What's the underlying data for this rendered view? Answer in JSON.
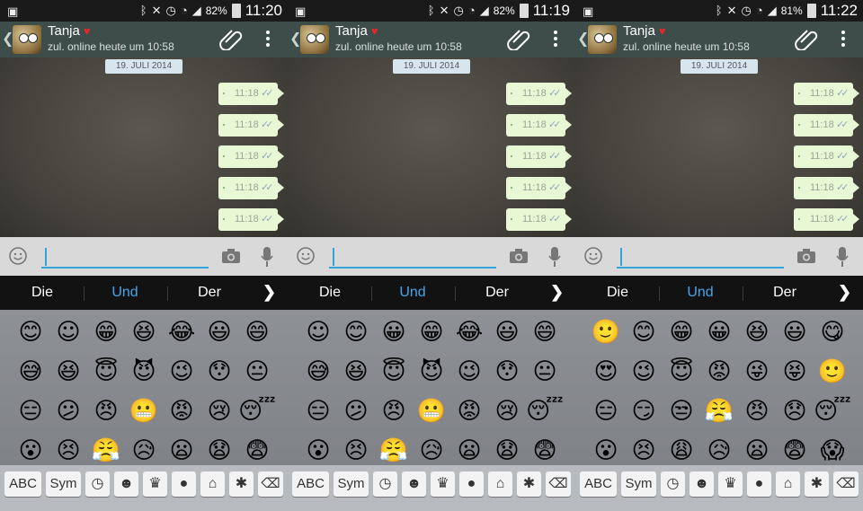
{
  "panels": [
    {
      "status": {
        "battery": "82%",
        "time": "11:20"
      },
      "chat": {
        "contact_name": "Tanja",
        "heart": "♥",
        "contact_status": "zul. online heute um 10:58",
        "date_pill": "19. JULI 2014",
        "messages": [
          {
            "time": "11:18",
            "ticks": "✓✓"
          },
          {
            "time": "11:18",
            "ticks": "✓✓"
          },
          {
            "time": "11:18",
            "ticks": "✓✓"
          },
          {
            "time": "11:18",
            "ticks": "✓✓"
          },
          {
            "time": "11:18",
            "ticks": "✓✓"
          }
        ]
      },
      "suggestions": [
        "Die",
        "Und",
        "Der"
      ],
      "emoji": [
        "😊",
        "☺",
        "😁",
        "😆",
        "😂",
        "😃",
        "😄",
        "😅",
        "😆",
        "😇",
        "😈",
        "😉",
        "😯",
        "😐",
        "😑",
        "😕",
        "😠",
        "😬",
        "😡",
        "😢",
        "😴",
        "😮",
        "😣",
        "😤",
        "😥",
        "😦",
        "😧",
        "😨"
      ],
      "keys": {
        "abc": "ABC",
        "sym": "Sym"
      }
    },
    {
      "status": {
        "battery": "82%",
        "time": "11:19"
      },
      "chat": {
        "contact_name": "Tanja",
        "heart": "♥",
        "contact_status": "zul. online heute um 10:58",
        "date_pill": "19. JULI 2014",
        "messages": [
          {
            "time": "11:18",
            "ticks": "✓✓"
          },
          {
            "time": "11:18",
            "ticks": "✓✓"
          },
          {
            "time": "11:18",
            "ticks": "✓✓"
          },
          {
            "time": "11:18",
            "ticks": "✓✓"
          },
          {
            "time": "11:18",
            "ticks": "✓✓"
          }
        ]
      },
      "suggestions": [
        "Die",
        "Und",
        "Der"
      ],
      "emoji": [
        "☺",
        "😊",
        "😀",
        "😁",
        "😂",
        "😃",
        "😄",
        "😅",
        "😆",
        "😇",
        "😈",
        "😉",
        "😯",
        "😐",
        "😑",
        "😕",
        "😠",
        "😬",
        "😡",
        "😢",
        "😴",
        "😮",
        "😣",
        "😤",
        "😥",
        "😦",
        "😧",
        "😨"
      ],
      "keys": {
        "abc": "ABC",
        "sym": "Sym"
      }
    },
    {
      "status": {
        "battery": "81%",
        "time": "11:22"
      },
      "chat": {
        "contact_name": "Tanja",
        "heart": "♥",
        "contact_status": "zul. online heute um 10:58",
        "date_pill": "19. JULI 2014",
        "messages": [
          {
            "time": "11:18",
            "ticks": "✓✓"
          },
          {
            "time": "11:18",
            "ticks": "✓✓"
          },
          {
            "time": "11:18",
            "ticks": "✓✓"
          },
          {
            "time": "11:18",
            "ticks": "✓✓"
          },
          {
            "time": "11:18",
            "ticks": "✓✓"
          }
        ]
      },
      "suggestions": [
        "Die",
        "Und",
        "Der"
      ],
      "emoji": [
        "🙂",
        "😊",
        "😁",
        "😀",
        "😆",
        "😃",
        "😋",
        "😍",
        "😉",
        "😇",
        "😡",
        "😜",
        "😝",
        "🙂",
        "😑",
        "😏",
        "😒",
        "😤",
        "😠",
        "😞",
        "😴",
        "😮",
        "😣",
        "😩",
        "😥",
        "😦",
        "😨",
        "😱"
      ],
      "keys": {
        "abc": "ABC",
        "sym": "Sym"
      }
    }
  ],
  "colors": {
    "header": "#3d4d4a",
    "bubble": "#e8f7d4",
    "accent": "#42a6e6",
    "input_line": "#33a3d8"
  },
  "icons": {
    "status": [
      "bluetooth-icon",
      "mute-icon",
      "alarm-icon",
      "wifi-icon",
      "signal-icon"
    ],
    "emoji_tabs": [
      "recent-icon",
      "smiley-icon",
      "crown-icon",
      "dog-icon",
      "house-icon",
      "asterisk-icon",
      "backspace-icon"
    ]
  }
}
